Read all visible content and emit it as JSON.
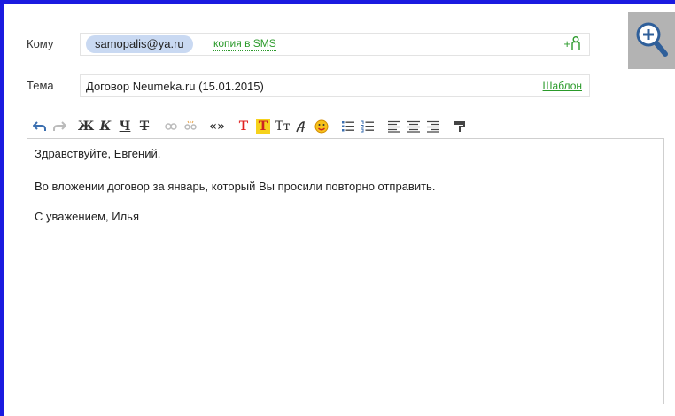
{
  "compose": {
    "to_label": "Кому",
    "recipient": "samopalis@ya.ru",
    "sms_copy_label": "копия в SMS",
    "add_contact_label": "+",
    "subject_label": "Тема",
    "subject_value": "Договор Neumeka.ru (15.01.2015)",
    "template_label": "Шаблон"
  },
  "toolbar": {
    "bold": "Ж",
    "italic": "К",
    "underline": "Ч",
    "strike": "Т",
    "quote": "«»",
    "text_color": "T",
    "bg_color": "T",
    "font_size": "Tт",
    "clear_format": "¶"
  },
  "body": {
    "line1": "Здравствуйте, Евгений.",
    "line2": "Во вложении договор за январь, который Вы просили повторно отправить.",
    "line3": "С уважением, Илья"
  },
  "colors": {
    "accent_green": "#2a9a2a",
    "chip_bg": "#c9d9f2",
    "frame_blue": "#1a1ae0"
  }
}
